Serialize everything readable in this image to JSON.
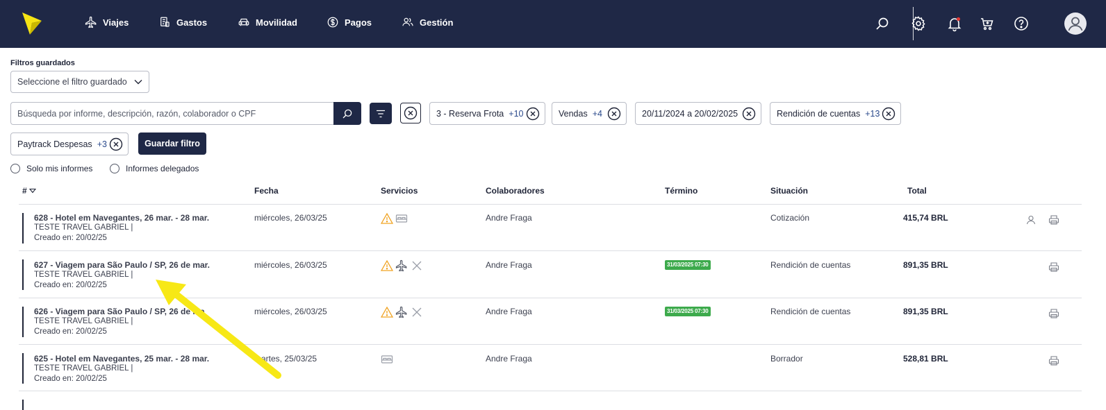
{
  "nav": {
    "items": [
      {
        "label": "Viajes",
        "icon": "plane-icon"
      },
      {
        "label": "Gastos",
        "icon": "receipt-icon"
      },
      {
        "label": "Movilidad",
        "icon": "car-icon"
      },
      {
        "label": "Pagos",
        "icon": "dollar-icon"
      },
      {
        "label": "Gestión",
        "icon": "users-icon"
      }
    ]
  },
  "filters": {
    "saved_label": "Filtros guardados",
    "saved_select": "Seleccione el filtro guardado",
    "search_placeholder": "Búsqueda por informe, descripción, razón, colaborador o CPF",
    "chips": [
      {
        "label": "3 - Reserva Frota",
        "more": "+10"
      },
      {
        "label": "Vendas",
        "more": "+4"
      },
      {
        "label": "20/11/2024 a 20/02/2025",
        "more": ""
      },
      {
        "label": "Rendición de cuentas",
        "more": "+13"
      },
      {
        "label": "Paytrack Despesas",
        "more": "+3"
      }
    ],
    "save_button": "Guardar filtro",
    "radios": [
      "Solo mis informes",
      "Informes delegados"
    ]
  },
  "table": {
    "headers": [
      "#",
      "Fecha",
      "Servicios",
      "Colaboradores",
      "Término",
      "Situación",
      "Total"
    ],
    "rows": [
      {
        "title": "628 - Hotel em Navegantes, 26 mar. - 28 mar.",
        "company": "TESTE TRAVEL GABRIEL |",
        "created": "Creado en: 20/02/25",
        "date": "miércoles, 26/03/25",
        "collaborator": "Andre Fraga",
        "term": "",
        "status": "Cotización",
        "total": "415,74 BRL"
      },
      {
        "title": "627 - Viagem para São Paulo / SP, 26 de mar.",
        "company": "TESTE TRAVEL GABRIEL |",
        "created": "Creado en: 20/02/25",
        "date": "miércoles, 26/03/25",
        "collaborator": "Andre Fraga",
        "term": "31/03/2025 07:30",
        "status": "Rendición de cuentas",
        "total": "891,35 BRL"
      },
      {
        "title": "626 - Viagem para São Paulo / SP, 26 de ma",
        "company": "TESTE TRAVEL GABRIEL |",
        "created": "Creado en: 20/02/25",
        "date": "miércoles, 26/03/25",
        "collaborator": "Andre Fraga",
        "term": "31/03/2025 07:30",
        "status": "Rendición de cuentas",
        "total": "891,35 BRL"
      },
      {
        "title": "625 - Hotel em Navegantes, 25 mar. - 28 mar.",
        "company": "TESTE TRAVEL GABRIEL |",
        "created": "Creado en: 20/02/25",
        "date": "martes, 25/03/25",
        "collaborator": "Andre Fraga",
        "term": "",
        "status": "Borrador",
        "total": "528,81 BRL"
      }
    ]
  },
  "colors": {
    "navy": "#1f2846",
    "badge_green": "#3daa4c",
    "warning": "#f0a323",
    "logo_yellow": "#f5e414",
    "arrow_yellow": "#f7e816"
  }
}
